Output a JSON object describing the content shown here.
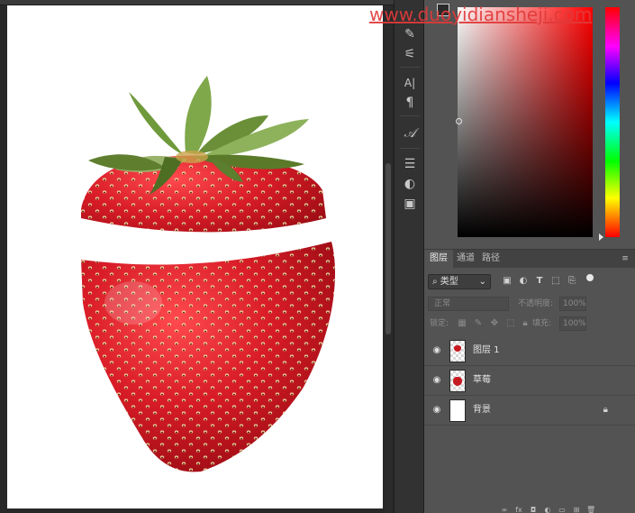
{
  "watermark": {
    "text": "www.duoyidiansheji.com"
  },
  "tools": [
    {
      "icon": "brush-icon",
      "glyph": "✎"
    },
    {
      "icon": "adjust-sliders-icon",
      "glyph": "⚟"
    },
    {
      "icon": "character-icon",
      "glyph": "A|"
    },
    {
      "icon": "paragraph-icon",
      "glyph": "¶"
    },
    {
      "icon": "glyph-icon",
      "glyph": "𝒜"
    },
    {
      "icon": "properties-icon",
      "glyph": "☰"
    },
    {
      "icon": "adjustments-icon",
      "glyph": "◐"
    },
    {
      "icon": "libraries-icon",
      "glyph": "▣"
    }
  ],
  "layers_panel": {
    "tabs": [
      {
        "label": "图层"
      },
      {
        "label": "通道"
      },
      {
        "label": "路径"
      }
    ],
    "filter": {
      "label": "类型"
    },
    "blend_mode": "正常",
    "opacity_label": "不透明度:",
    "opacity_value": "100%",
    "lock_label": "锁定:",
    "fill_label": "填充:",
    "fill_value": "100%",
    "layers": [
      {
        "name": "图层 1",
        "thumbnail": "transparent-with-art",
        "locked": false
      },
      {
        "name": "草莓",
        "thumbnail": "transparent-with-art",
        "locked": false
      },
      {
        "name": "背景",
        "thumbnail": "white",
        "locked": true
      }
    ]
  },
  "colors": {
    "workspace": "#282828",
    "panel": "#535353",
    "strawberry": "#c81a22",
    "watermark": "#e23a3a"
  }
}
